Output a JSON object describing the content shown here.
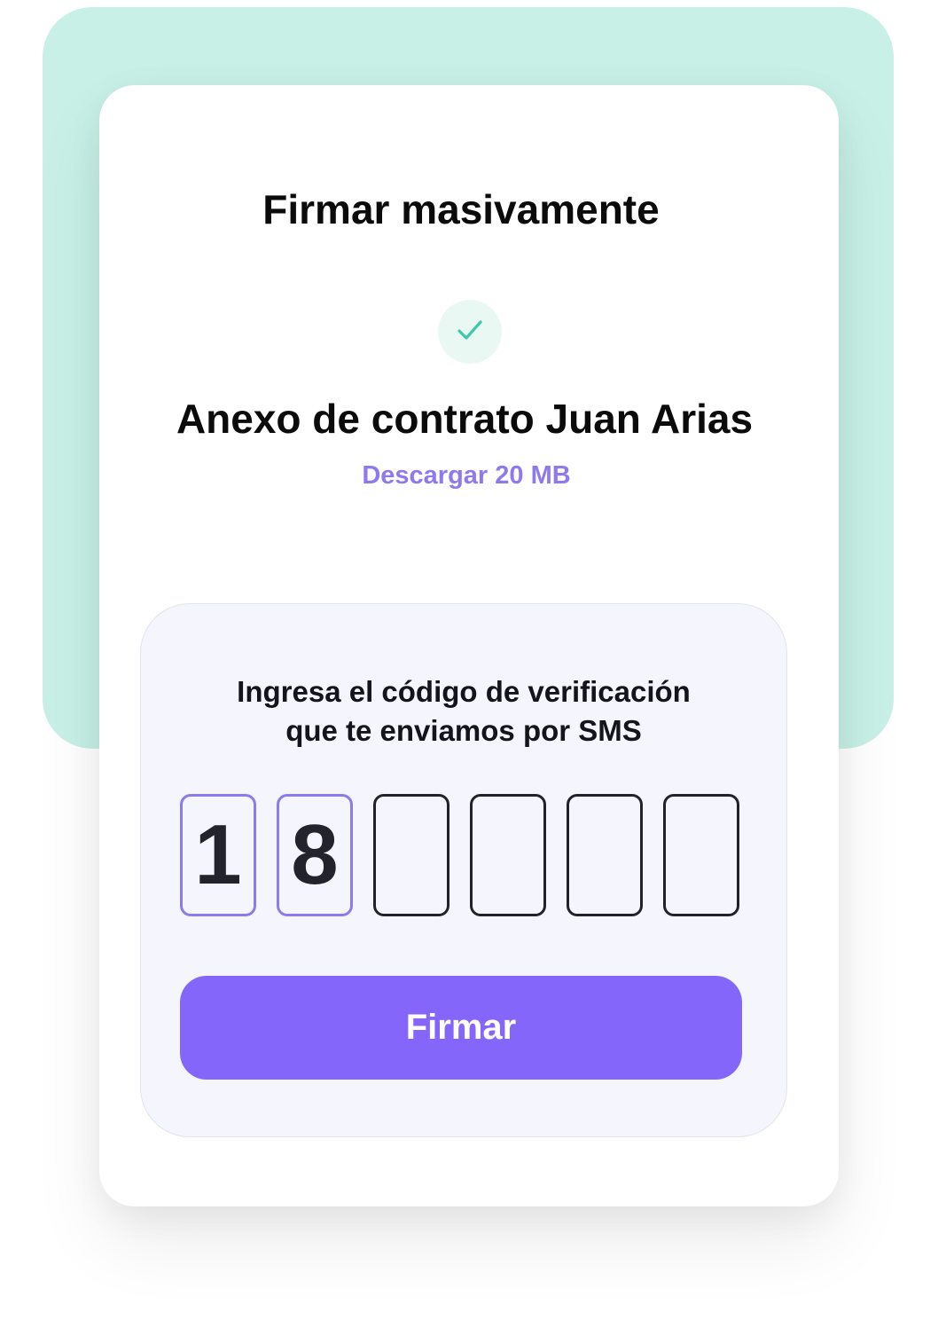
{
  "dialog": {
    "title": "Firmar masivamente"
  },
  "document": {
    "status_icon": "check-icon",
    "name": "Anexo de contrato Juan Arias",
    "download_label": "Descargar 20 MB"
  },
  "verification": {
    "instructions_line1": "Ingresa el código de verificación",
    "instructions_line2": "que te enviamos por SMS",
    "digits": [
      "1",
      "8",
      "",
      "",
      "",
      ""
    ],
    "submit_label": "Firmar"
  },
  "colors": {
    "accent": "#8566fb",
    "link": "#8f79ef",
    "mint_background": "#c8f0e6",
    "success_check": "#3cc9a8"
  }
}
